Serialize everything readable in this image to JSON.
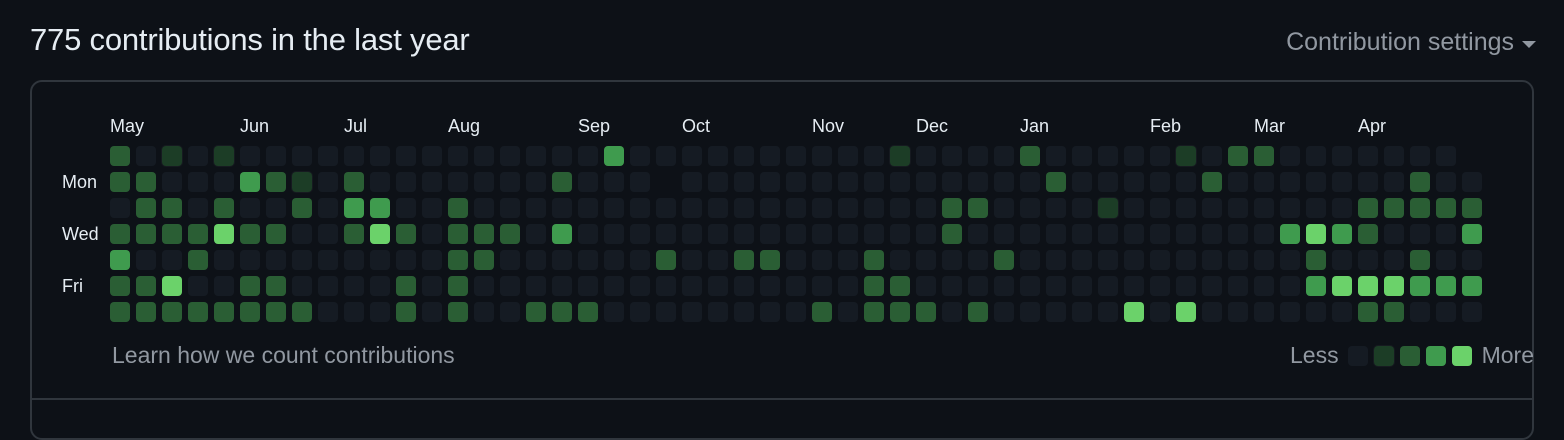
{
  "header": {
    "title": "775 contributions in the last year",
    "settings_label": "Contribution settings"
  },
  "graph": {
    "months": [
      {
        "label": "May",
        "week": 0
      },
      {
        "label": "Jun",
        "week": 5
      },
      {
        "label": "Jul",
        "week": 9
      },
      {
        "label": "Aug",
        "week": 13
      },
      {
        "label": "Sep",
        "week": 18
      },
      {
        "label": "Oct",
        "week": 22
      },
      {
        "label": "Nov",
        "week": 27
      },
      {
        "label": "Dec",
        "week": 31
      },
      {
        "label": "Jan",
        "week": 35
      },
      {
        "label": "Feb",
        "week": 40
      },
      {
        "label": "Mar",
        "week": 44
      },
      {
        "label": "Apr",
        "week": 48
      }
    ],
    "day_labels": [
      {
        "label": "Mon",
        "row": 1
      },
      {
        "label": "Wed",
        "row": 3
      },
      {
        "label": "Fri",
        "row": 5
      }
    ],
    "levels": [
      "2010100000000000000300000000001000020000010220000000",
      "22000321020000000200050000000000000020000020000000200",
      "02202002033002000000000000000000220000100000000022222",
      "222242200242022203000000000000002000000000000343200032",
      "30020000000002200000020022000200002000000000002000200022",
      "22400220000202000000000000000220000000000000003444333",
      "22222222000202002220000000020222020000040400000022000002"
    ],
    "colors": [
      "#151b23",
      "#1c3d26",
      "#2a5e34",
      "#3f9b4e",
      "#6bd26a"
    ]
  },
  "footer": {
    "learn_link": "Learn how we count contributions",
    "legend_less": "Less",
    "legend_more": "More"
  }
}
